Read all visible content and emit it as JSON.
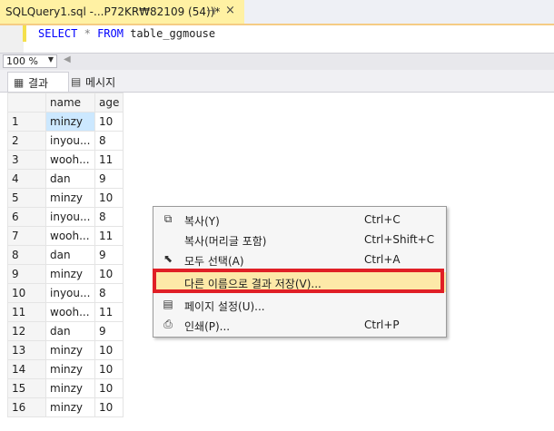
{
  "document_tab": {
    "title": "SQLQuery1.sql -...P72KR₩82109 (54))*",
    "pin_icon": "pin-icon",
    "close_label": "×"
  },
  "editor": {
    "keyword_select": "SELECT",
    "star": "*",
    "keyword_from": "FROM",
    "table": "table_ggmouse"
  },
  "zoom": {
    "value": "100 %"
  },
  "result_tabs": [
    {
      "label": "결과",
      "icon": "grid-icon"
    },
    {
      "label": "메시지",
      "icon": "messages-icon"
    }
  ],
  "grid": {
    "columns": [
      "name",
      "age"
    ],
    "rows": [
      [
        "1",
        "minzy",
        "10"
      ],
      [
        "2",
        "inyou...",
        "8"
      ],
      [
        "3",
        "wooh...",
        "11"
      ],
      [
        "4",
        "dan",
        "9"
      ],
      [
        "5",
        "minzy",
        "10"
      ],
      [
        "6",
        "inyou...",
        "8"
      ],
      [
        "7",
        "wooh...",
        "11"
      ],
      [
        "8",
        "dan",
        "9"
      ],
      [
        "9",
        "minzy",
        "10"
      ],
      [
        "10",
        "inyou...",
        "8"
      ],
      [
        "11",
        "wooh...",
        "11"
      ],
      [
        "12",
        "dan",
        "9"
      ],
      [
        "13",
        "minzy",
        "10"
      ],
      [
        "14",
        "minzy",
        "10"
      ],
      [
        "15",
        "minzy",
        "10"
      ],
      [
        "16",
        "minzy",
        "10"
      ]
    ]
  },
  "context_menu": {
    "items": [
      {
        "label": "복사(Y)",
        "shortcut": "Ctrl+C",
        "icon": "copy-icon"
      },
      {
        "label": "복사(머리글 포함)",
        "shortcut": "Ctrl+Shift+C",
        "icon": ""
      },
      {
        "label": "모두 선택(A)",
        "shortcut": "Ctrl+A",
        "icon": "select-all-icon"
      },
      {
        "label": "다른 이름으로 결과 저장(V)...",
        "shortcut": "",
        "icon": ""
      },
      {
        "label": "페이지 설정(U)...",
        "shortcut": "",
        "icon": "page-setup-icon"
      },
      {
        "label": "인쇄(P)...",
        "shortcut": "Ctrl+P",
        "icon": "print-icon"
      }
    ]
  },
  "colors": {
    "highlight_box": "#e01f26",
    "active_tab": "#fff1a3",
    "selected_cell": "#cce8ff",
    "keyword": "#0000ff"
  }
}
